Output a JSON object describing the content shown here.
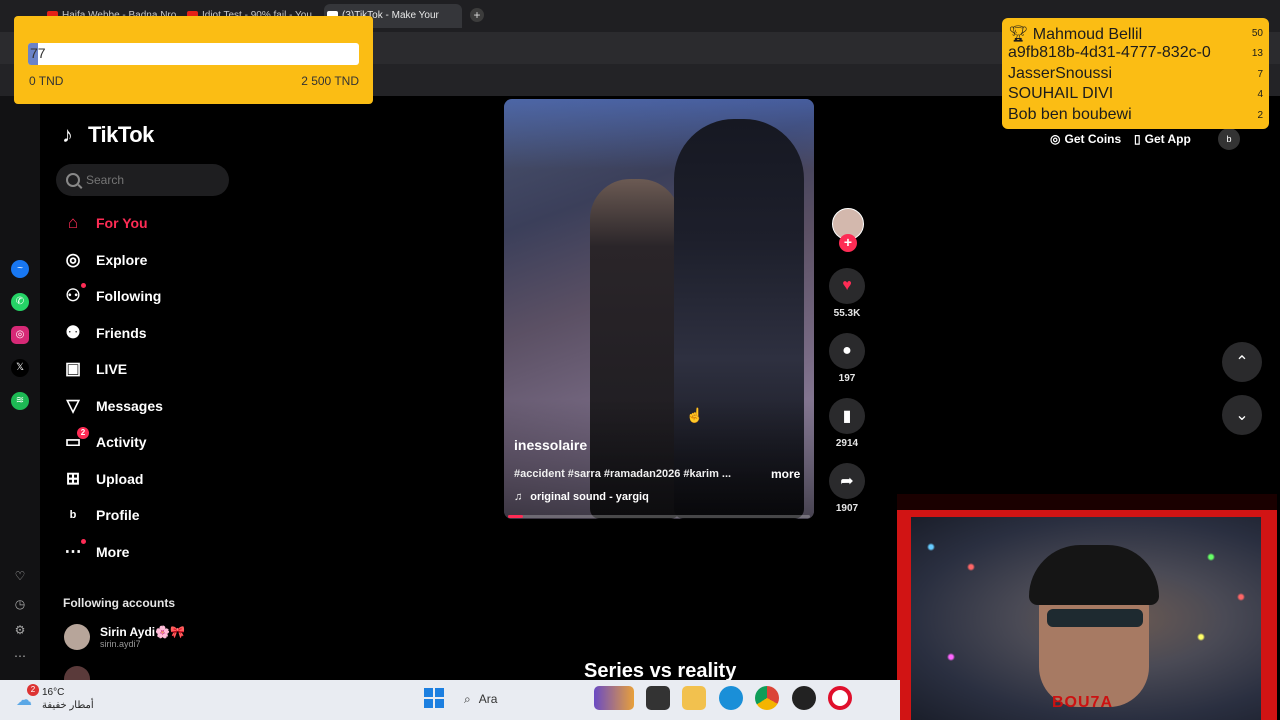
{
  "browser": {
    "tabs": [
      {
        "title": "Haifa Wehbe - Badna Nro..."
      },
      {
        "title": "Idiot Test - 90% fail - You..."
      },
      {
        "title": "(3)TikTok - Make Your"
      }
    ],
    "new_tab": "+"
  },
  "tiktok": {
    "logo": "TikTok",
    "search_placeholder": "Search",
    "nav": [
      {
        "label": "For You",
        "icon": "home-icon"
      },
      {
        "label": "Explore",
        "icon": "compass-icon"
      },
      {
        "label": "Following",
        "icon": "following-icon"
      },
      {
        "label": "Friends",
        "icon": "friends-icon"
      },
      {
        "label": "LIVE",
        "icon": "live-icon"
      },
      {
        "label": "Messages",
        "icon": "messages-icon"
      },
      {
        "label": "Activity",
        "icon": "activity-icon",
        "badge": "2"
      },
      {
        "label": "Upload",
        "icon": "upload-icon"
      },
      {
        "label": "Profile",
        "icon": "profile-icon"
      },
      {
        "label": "More",
        "icon": "more-icon"
      }
    ],
    "following_accounts_title": "Following accounts",
    "accounts": [
      {
        "name": "Sirin Aydi🌸🎀",
        "handle": "sirin.aydi7"
      }
    ],
    "header": {
      "get_coins": "Get Coins",
      "get_app": "Get App",
      "profile_initial": "b"
    },
    "video": {
      "author": "inessolaire",
      "caption": "#accident #sarra #ramadan2026 #karim ...",
      "more": "more",
      "sound": "original sound - yargiq",
      "progress": 0.05
    },
    "actions": {
      "likes": "55.3K",
      "comments": "197",
      "saves": "2914",
      "shares": "1907"
    },
    "next_video_title": "Series vs reality"
  },
  "overlay_goal": {
    "current": "77",
    "min": "0 TND",
    "max": "2 500 TND",
    "progress": 0.03
  },
  "overlay_leaderboard": [
    {
      "name": "Mahmoud Bellil",
      "score": "50"
    },
    {
      "name": "a9fb818b-4d31-4777-832c-0",
      "score": "13"
    },
    {
      "name": "JasserSnoussi",
      "score": "7"
    },
    {
      "name": "SOUHAIL DIVI",
      "score": "4"
    },
    {
      "name": "Bob ben boubewi",
      "score": "2"
    }
  ],
  "webcam": {
    "name": "BOU7A"
  },
  "taskbar": {
    "weather_temp": "16°C",
    "weather_desc": "أمطار خفيفة",
    "weather_badge": "2",
    "search": "Ara"
  },
  "colors": {
    "accent": "#fe2c55",
    "overlay": "#fbbd14",
    "cam_frame": "#d11414"
  }
}
